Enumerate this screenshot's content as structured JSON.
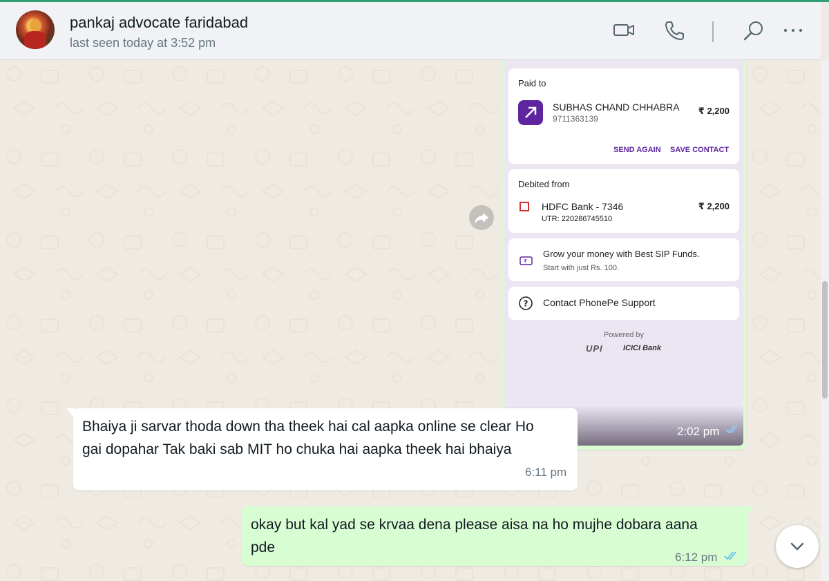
{
  "header": {
    "contact_name": "pankaj advocate faridabad",
    "last_seen": "last seen today at 3:52 pm",
    "icons": [
      "video-call-icon",
      "voice-call-icon",
      "search-icon",
      "menu-icon"
    ]
  },
  "messages": [
    {
      "type": "image",
      "direction": "outgoing",
      "time": "2:02 pm",
      "status": "read",
      "receipt": {
        "paid_to_label": "Paid to",
        "payee_name": "SUBHAS CHAND CHHABRA",
        "payee_phone": "9711363139",
        "amount": "₹ 2,200",
        "send_again": "SEND AGAIN",
        "save_contact": "SAVE CONTACT",
        "debited_from_label": "Debited from",
        "bank": "HDFC Bank - 7346",
        "debit_amount": "₹ 2,200",
        "utr": "UTR: 220286745510",
        "sip_title": "Grow your money with Best SIP Funds.",
        "sip_sub": "Start with just Rs. 100.",
        "support": "Contact PhonePe Support",
        "powered_by": "Powered by",
        "upi_logo": "UPI",
        "bank_logo": "ICICI Bank"
      }
    },
    {
      "type": "text",
      "direction": "incoming",
      "line1": "Bhaiya ji sarvar thoda down tha theek hai cal aapka online se clear Ho",
      "line2": "gai dopahar Tak baki sab MIT ho chuka hai aapka theek hai bhaiya",
      "time": "6:11 pm"
    },
    {
      "type": "text",
      "direction": "outgoing",
      "line1": "okay but kal yad se krvaa dena please aisa na ho mujhe dobara aana",
      "line2": "pde",
      "time": "6:12 pm",
      "status": "read"
    }
  ],
  "colors": {
    "header_bg": "#f0f2f5",
    "chat_bg": "#efeae2",
    "outgoing_bubble": "#d9fdd3",
    "incoming_bubble": "#ffffff",
    "read_tick": "#53bdeb",
    "phonepe_purple": "#5f259f"
  }
}
